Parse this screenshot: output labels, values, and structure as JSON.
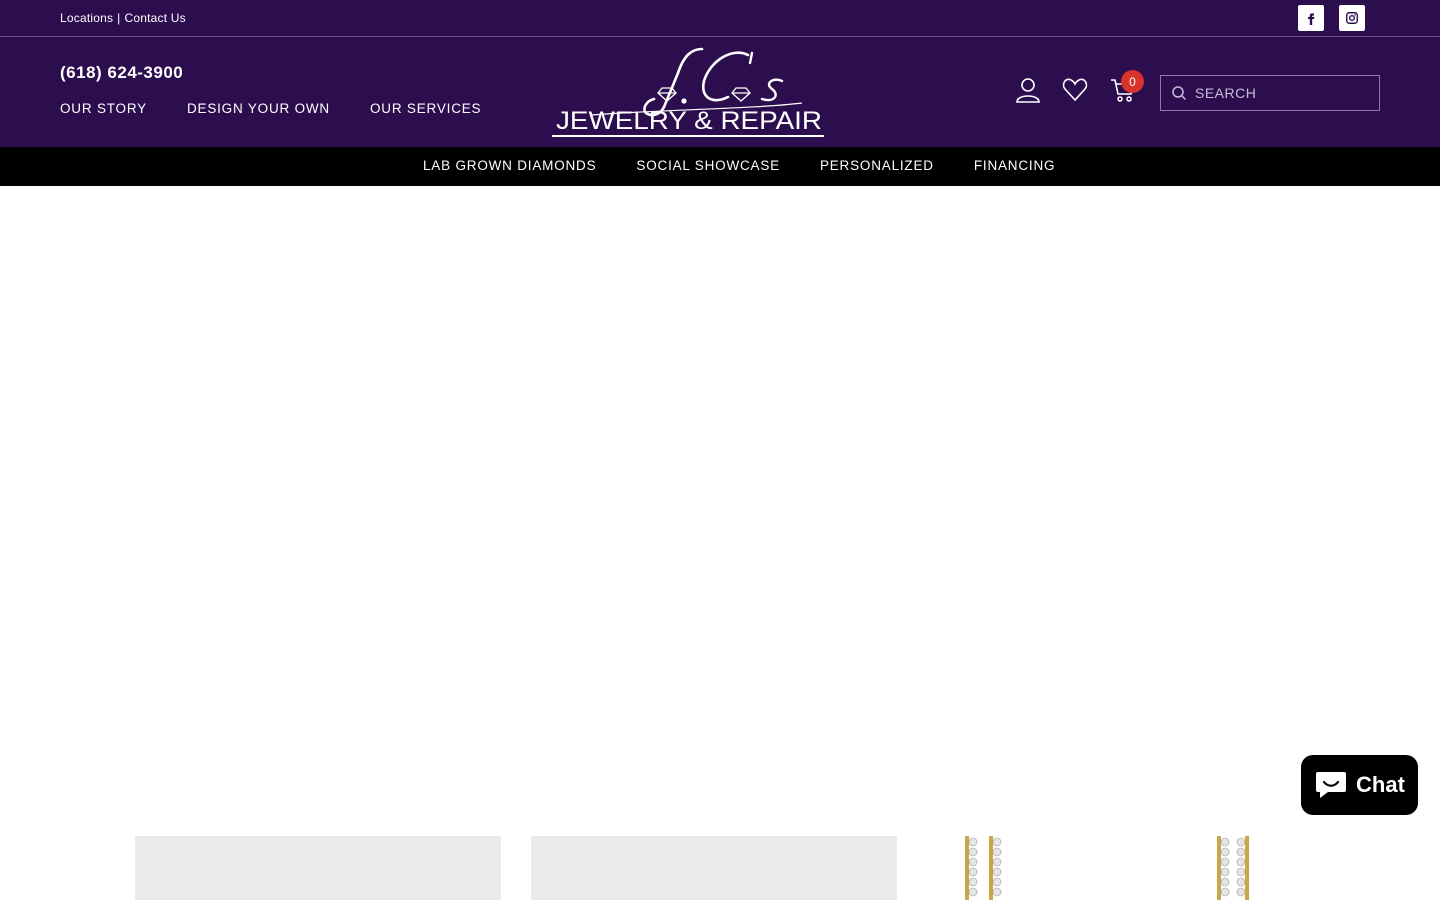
{
  "topbar": {
    "links": [
      "Locations",
      "Contact Us"
    ],
    "separator": "|",
    "social": [
      "facebook-icon",
      "instagram-icon"
    ]
  },
  "header": {
    "phone": "(618) 624-3900",
    "left_nav": [
      "OUR STORY",
      "DESIGN YOUR OWN",
      "OUR SERVICES"
    ],
    "logo": {
      "line1": "J.C's",
      "line2": "JEWELRY & REPAIR"
    },
    "cart_count": "0",
    "search": {
      "placeholder": "SEARCH"
    }
  },
  "main_nav": [
    "LAB GROWN DIAMONDS",
    "SOCIAL SHOWCASE",
    "PERSONALIZED",
    "FINANCING"
  ],
  "chat": {
    "label": "Chat"
  },
  "colors": {
    "brand_purple": "#2c0e4f",
    "nav_black": "#000000",
    "badge_red": "#d9342b"
  }
}
